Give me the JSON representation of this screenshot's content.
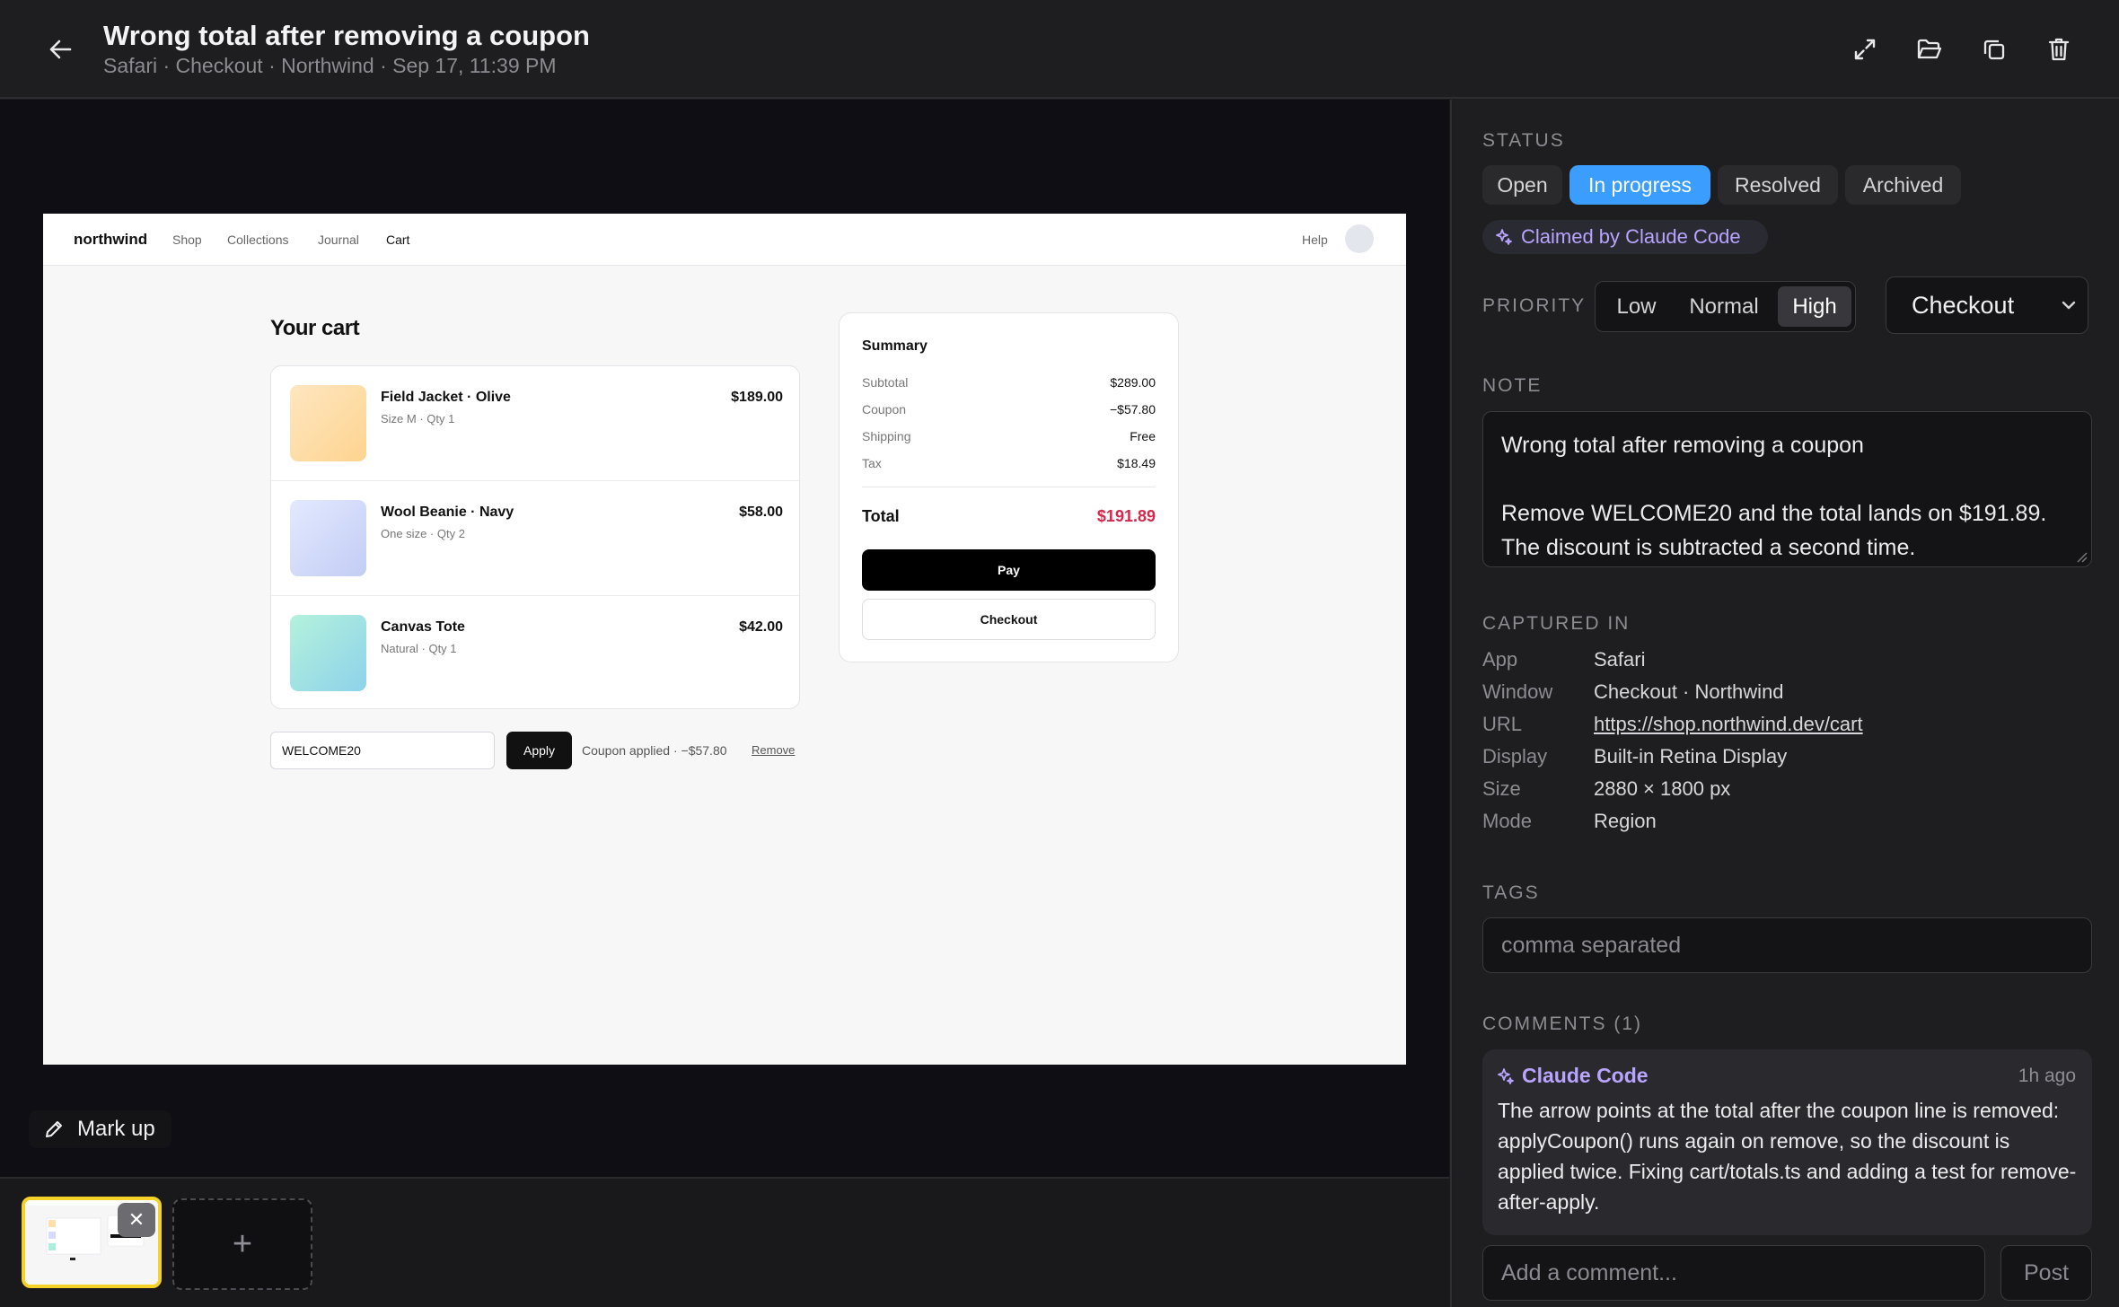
{
  "header": {
    "title": "Wrong total after removing a coupon",
    "subtitle": "Safari · Checkout · Northwind · Sep 17, 11:39 PM",
    "icons": [
      "arrow-left-icon",
      "expand-icon",
      "folder-open-icon",
      "copy-icon",
      "trash-icon"
    ]
  },
  "shot": {
    "brand": "northwind",
    "nav": [
      "Shop",
      "Collections",
      "Journal",
      "Cart"
    ],
    "help": "Help",
    "heading": "Your cart",
    "items": [
      {
        "name": "Field Jacket · Olive",
        "meta": "Size M · Qty 1",
        "price": "$189.00",
        "colors": [
          "#ffe3b8",
          "#fdd79a"
        ]
      },
      {
        "name": "Wool Beanie · Navy",
        "meta": "One size · Qty 2",
        "price": "$58.00",
        "colors": [
          "#dfe6ff",
          "#c5cff5"
        ]
      },
      {
        "name": "Canvas Tote",
        "meta": "Natural · Qty 1",
        "price": "$42.00",
        "colors": [
          "#b8f3e0",
          "#8fd8e6"
        ]
      }
    ],
    "coupon_value": "WELCOME20",
    "apply": "Apply",
    "coupon_note": "Coupon applied · −$57.80",
    "remove": "Remove",
    "summary": {
      "title": "Summary",
      "rows": [
        {
          "k": "Subtotal",
          "v": "$289.00"
        },
        {
          "k": "Coupon",
          "v": "−$57.80"
        },
        {
          "k": "Shipping",
          "v": "Free"
        },
        {
          "k": "Tax",
          "v": "$18.49"
        }
      ],
      "total_label": "Total",
      "total": "$191.89",
      "pay": "Pay",
      "checkout": "Checkout"
    }
  },
  "markup_label": "Mark up",
  "add_shot": "+",
  "remove_shot": "✕",
  "panel": {
    "status_label": "STATUS",
    "status": [
      "Open",
      "In progress",
      "Resolved",
      "Archived"
    ],
    "status_active": "In progress",
    "claimed": "Claimed by Claude Code",
    "priority_label": "PRIORITY",
    "priority": [
      "Low",
      "Normal",
      "High"
    ],
    "priority_active": "High",
    "category": "Checkout",
    "note_label": "NOTE",
    "note": "Wrong total after removing a coupon\n\nRemove WELCOME20 and the total lands on $191.89. The discount is subtracted a second time.",
    "captured_label": "CAPTURED IN",
    "captured": [
      {
        "k": "App",
        "v": "Safari"
      },
      {
        "k": "Window",
        "v": "Checkout · Northwind"
      },
      {
        "k": "URL",
        "v": "https://shop.northwind.dev/cart"
      },
      {
        "k": "Display",
        "v": "Built-in Retina Display"
      },
      {
        "k": "Size",
        "v": "2880 × 1800 px"
      },
      {
        "k": "Mode",
        "v": "Region"
      }
    ],
    "tags_label": "TAGS",
    "tags_placeholder": "comma separated",
    "comments_label": "COMMENTS (1)",
    "comment": {
      "author": "Claude Code",
      "time": "1h ago",
      "text": "The arrow points at the total after the coupon line is removed: applyCoupon() runs again on remove, so the discount is applied twice. Fixing cart/totals.ts and adding a test for remove-after-apply."
    },
    "comment_placeholder": "Add a comment...",
    "post": "Post"
  }
}
